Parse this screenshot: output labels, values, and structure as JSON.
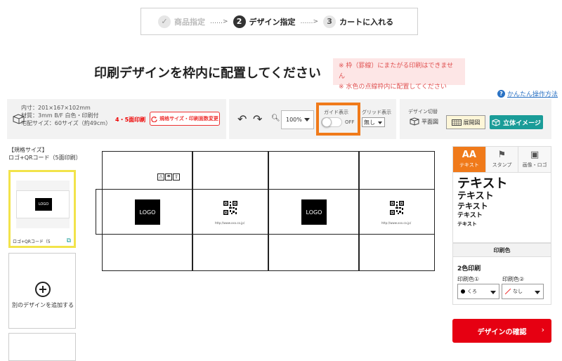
{
  "steps": [
    {
      "num": "✓",
      "label": "商品指定"
    },
    {
      "num": "2",
      "label": "デザイン指定"
    },
    {
      "num": "3",
      "label": "カートに入れる"
    }
  ],
  "step_arrow": "……>",
  "title": "印刷デザインを枠内に配置してください",
  "notice": [
    "※ 枠（罫線）にまたがる印刷はできません",
    "※ 水色の点線枠内に配置してください"
  ],
  "help_link": "かんたん操作方法",
  "product": {
    "specs": [
      "内寸：201×167×102mm",
      "材質：3mm B/F 白色・印刷付",
      "宅配サイズ：60サイズ（約49cm）"
    ],
    "faces": "4・5面印刷",
    "change_button": "規格サイズ・印刷面数変更"
  },
  "toolbar": {
    "zoom_value": "100%",
    "guide_label": "ガイド表示",
    "guide_state": "OFF",
    "grid_label": "グリッド表示",
    "grid_value": "無し"
  },
  "design_switch": {
    "label": "デザイン切替",
    "plan": "平面図",
    "unfold": "展開図",
    "solid": "立体イメージ"
  },
  "sidebar": {
    "standard_label": "【規格サイズ】",
    "design_name": "ロゴ+QRコード（5面印刷）",
    "thumb_caption": "ロゴ+QRコード（5",
    "thumb_logo": "LOGO",
    "add_design": "別のデザインを追加する"
  },
  "canvas": {
    "logo_text": "LOGO",
    "url_text": "http://www.xxx.co.jp/",
    "care_marks": [
      "⚠",
      "☂",
      "⇧"
    ]
  },
  "right_panel": {
    "tabs": [
      {
        "icon": "AA",
        "label": "テキスト"
      },
      {
        "icon": "⚑",
        "label": "スタンプ"
      },
      {
        "icon": "▣",
        "label": "画像・ロゴ"
      }
    ],
    "text_samples": [
      "テキスト",
      "テキスト",
      "テキスト",
      "テキスト",
      "テキスト"
    ],
    "print_color_header": "印刷色",
    "two_color": "2色印刷",
    "color1_label": "印刷色①",
    "color2_label": "印刷色②",
    "color1_value": "くろ",
    "color2_value": "なし",
    "confirm": "デザインの確認",
    "confirm_chevron": "›"
  },
  "colors": {
    "accent_orange": "#f07a1a",
    "confirm_red": "#e60012",
    "teal": "#1a9c98",
    "notice_bg": "#fde6e6"
  }
}
